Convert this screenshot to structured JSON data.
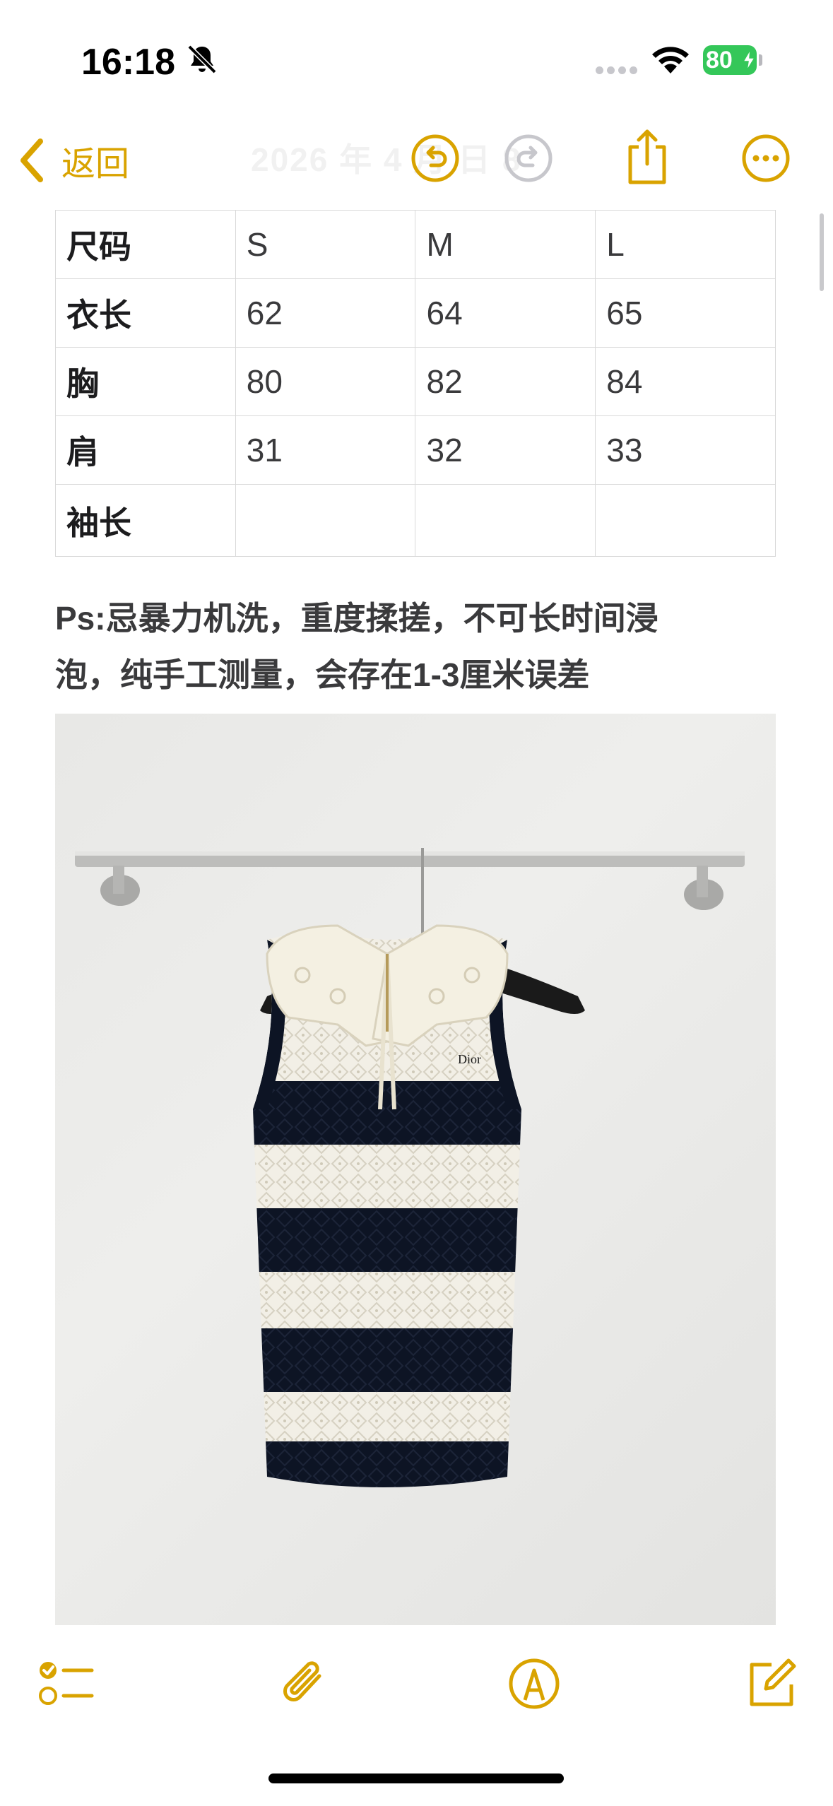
{
  "status_bar": {
    "time": "16:18",
    "battery_percent": "80",
    "icons": [
      "bell-slash-icon",
      "cellular-signal-icon",
      "wifi-icon",
      "battery-charging-icon"
    ]
  },
  "nav_bar": {
    "back_label": "返回",
    "faded_title": "2026 年 4 月 日 8",
    "icons": [
      "undo-icon",
      "redo-icon",
      "share-icon",
      "more-icon"
    ]
  },
  "size_table": {
    "rows": [
      [
        "尺码",
        "S",
        "M",
        "L"
      ],
      [
        "衣长",
        "62",
        "64",
        "65"
      ],
      [
        "胸",
        "80",
        "82",
        "84"
      ],
      [
        "肩",
        "31",
        "32",
        "33"
      ],
      [
        "袖长",
        "",
        "",
        ""
      ]
    ]
  },
  "note": {
    "line1": "Ps:忌暴力机洗，重度揉搓，不可长时间浸",
    "line2": "泡，纯手工测量，会存在1-3厘米误差"
  },
  "photo": {
    "brand_label": "Dior"
  },
  "toolbar": {
    "icons": [
      "checklist-icon",
      "attachment-icon",
      "markup-icon",
      "compose-icon"
    ]
  },
  "colors": {
    "accent": "#d9a300",
    "battery": "#34c759",
    "text": "#3a3a3c"
  }
}
